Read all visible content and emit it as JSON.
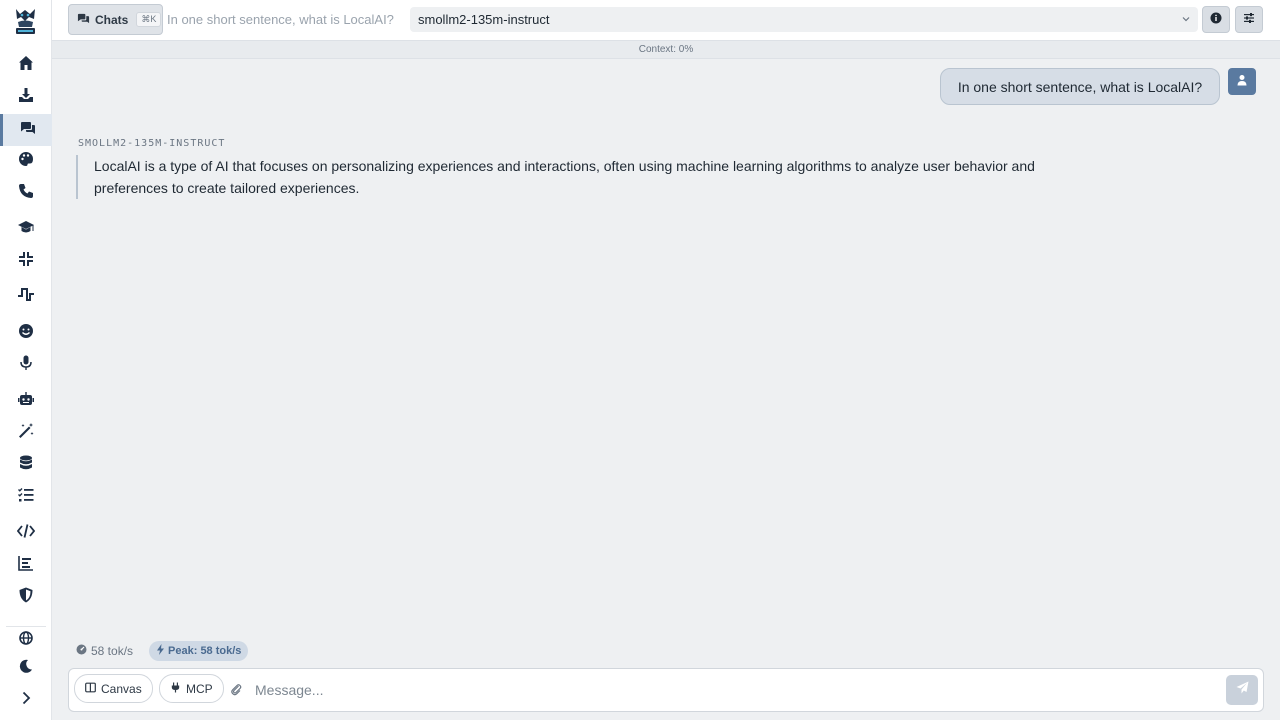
{
  "app": {
    "logo_label": "LocalAI"
  },
  "sidebar": {
    "items": [
      {
        "icon": "home-icon",
        "active": false
      },
      {
        "icon": "download-icon",
        "active": false
      },
      {
        "icon": "chat-icon",
        "active": true
      },
      {
        "icon": "palette-icon",
        "active": false
      },
      {
        "icon": "phone-icon",
        "active": false
      },
      {
        "icon": "graduation-cap-icon",
        "active": false
      },
      {
        "icon": "compress-icon",
        "active": false
      },
      {
        "icon": "waveform-icon",
        "active": false
      },
      {
        "icon": "smile-icon",
        "active": false
      },
      {
        "icon": "microphone-icon",
        "active": false
      },
      {
        "icon": "robot-icon",
        "active": false
      },
      {
        "icon": "magic-wand-icon",
        "active": false
      },
      {
        "icon": "database-icon",
        "active": false
      },
      {
        "icon": "list-check-icon",
        "active": false
      },
      {
        "icon": "code-icon",
        "active": false
      },
      {
        "icon": "bar-chart-icon",
        "active": false
      },
      {
        "icon": "shield-icon",
        "active": false
      },
      {
        "icon": "globe-icon",
        "active": false
      },
      {
        "icon": "moon-icon",
        "active": false
      },
      {
        "icon": "chevron-right-icon",
        "active": false
      }
    ]
  },
  "topbar": {
    "chats_label": "Chats",
    "chats_shortcut": "⌘K",
    "chat_title": "In one short sentence, what is LocalAI?",
    "model_selected": "smollm2-135m-instruct"
  },
  "context": {
    "label": "Context: 0%"
  },
  "messages": {
    "user_text": "In one short sentence, what is LocalAI?",
    "assistant_name": "smollm2-135m-instruct",
    "assistant_text": "LocalAI is a type of AI that focuses on personalizing experiences and interactions, often using machine learning algorithms to analyze user behavior and preferences to create tailored experiences."
  },
  "stats": {
    "speed": "58 tok/s",
    "peak": "Peak: 58 tok/s"
  },
  "composer": {
    "canvas_label": "Canvas",
    "mcp_label": "MCP",
    "placeholder": "Message..."
  },
  "colors": {
    "accent": "#5a7aa0",
    "sidebar_icon": "#1f2f45",
    "background": "#eef0f2"
  }
}
